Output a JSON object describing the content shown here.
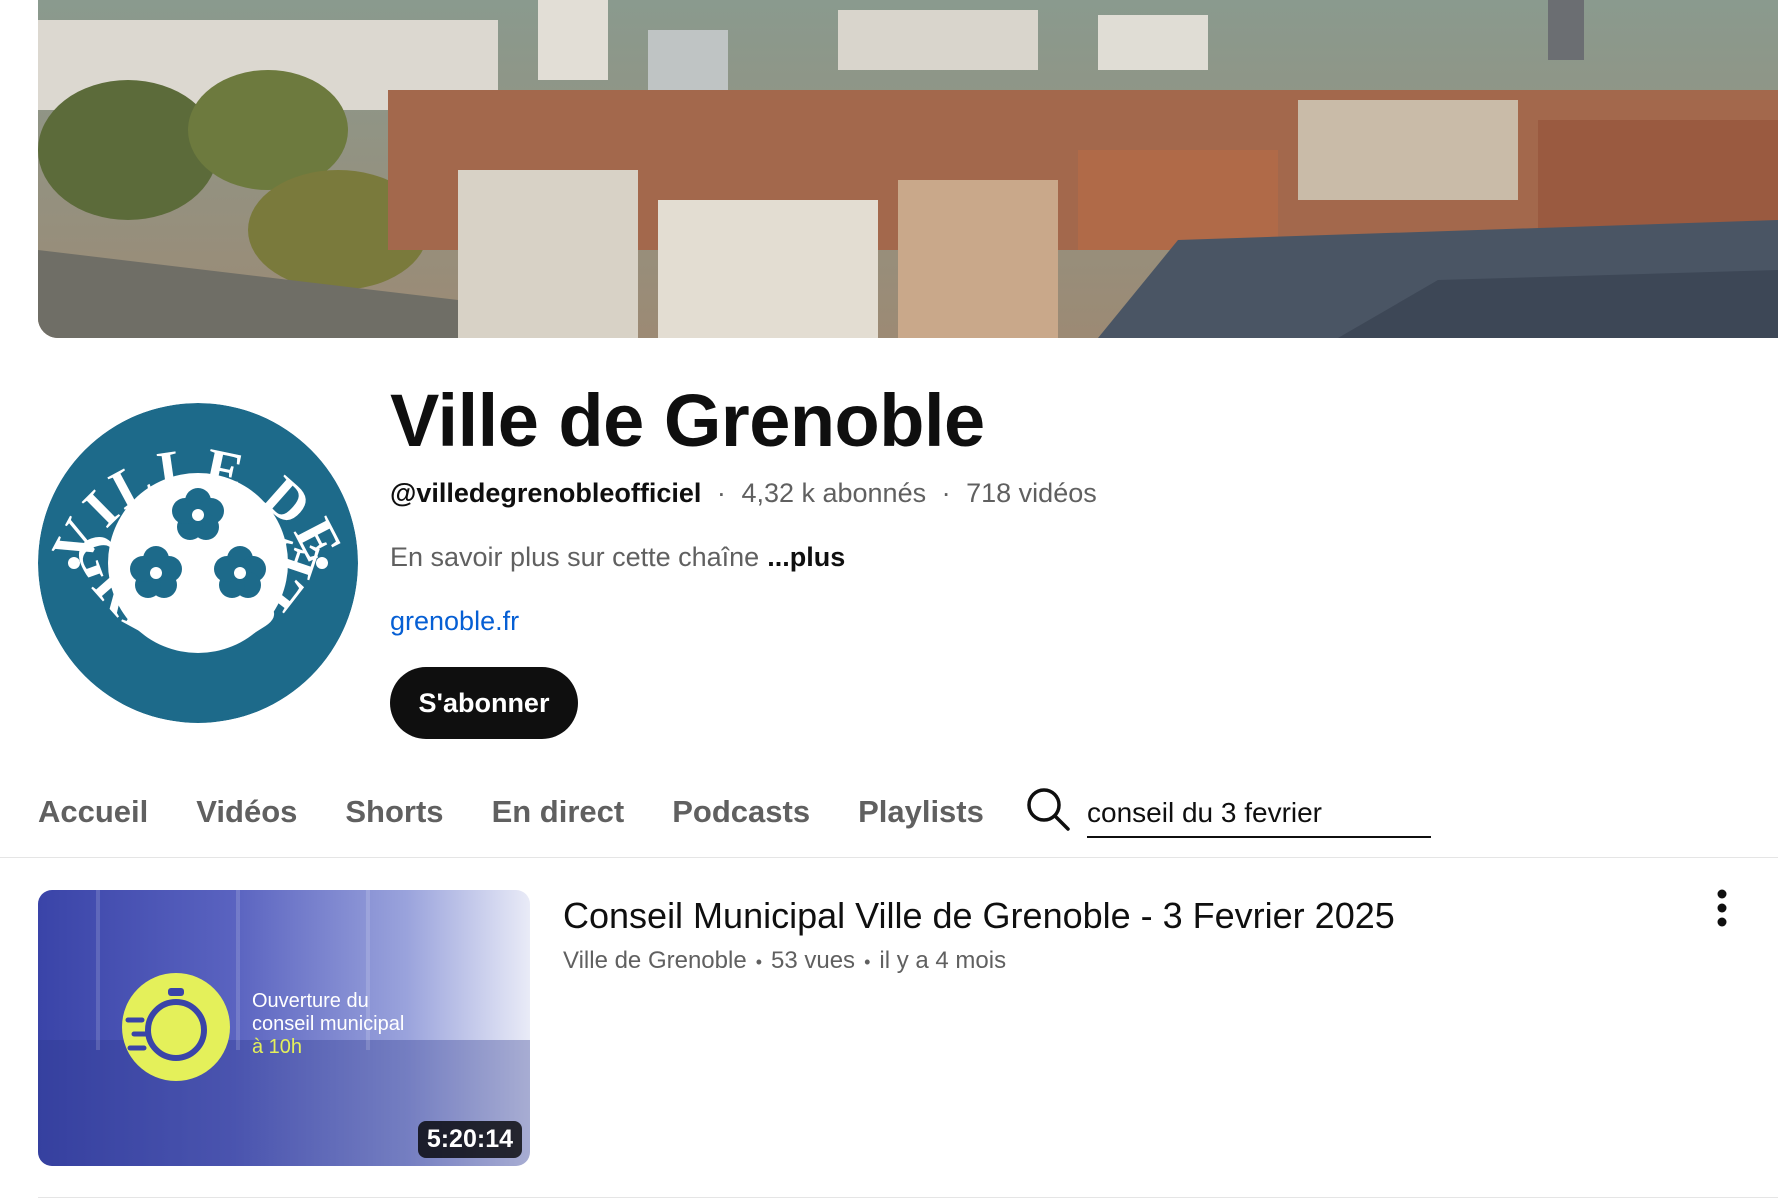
{
  "channel": {
    "name": "Ville de Grenoble",
    "handle": "@villedegrenobleofficiel",
    "subscribers": "4,32 k abonnés",
    "videos": "718 vidéos",
    "separator": "·",
    "about": "En savoir plus sur cette chaîne",
    "about_more": "...plus",
    "link": "grenoble.fr",
    "subscribe_label": "S'abonner",
    "avatar_text_top": "VILLE DE",
    "avatar_text_bottom": "GRENOBLE",
    "brand_color": "#1d6a8a"
  },
  "tabs": [
    {
      "label": "Accueil"
    },
    {
      "label": "Vidéos"
    },
    {
      "label": "Shorts"
    },
    {
      "label": "En direct"
    },
    {
      "label": "Podcasts"
    },
    {
      "label": "Playlists"
    }
  ],
  "search": {
    "icon": "search-icon",
    "value": "conseil du 3 fevrier"
  },
  "results": [
    {
      "title": "Conseil Municipal Ville de Grenoble - 3 Fevrier 2025",
      "channel": "Ville de Grenoble",
      "views": "53 vues",
      "age": "il y a 4 mois",
      "duration": "5:20:14",
      "thumb_line1": "Ouverture du",
      "thumb_line2": "conseil municipal",
      "thumb_line3": "à 10h",
      "accent_color": "#e4f05a"
    }
  ]
}
